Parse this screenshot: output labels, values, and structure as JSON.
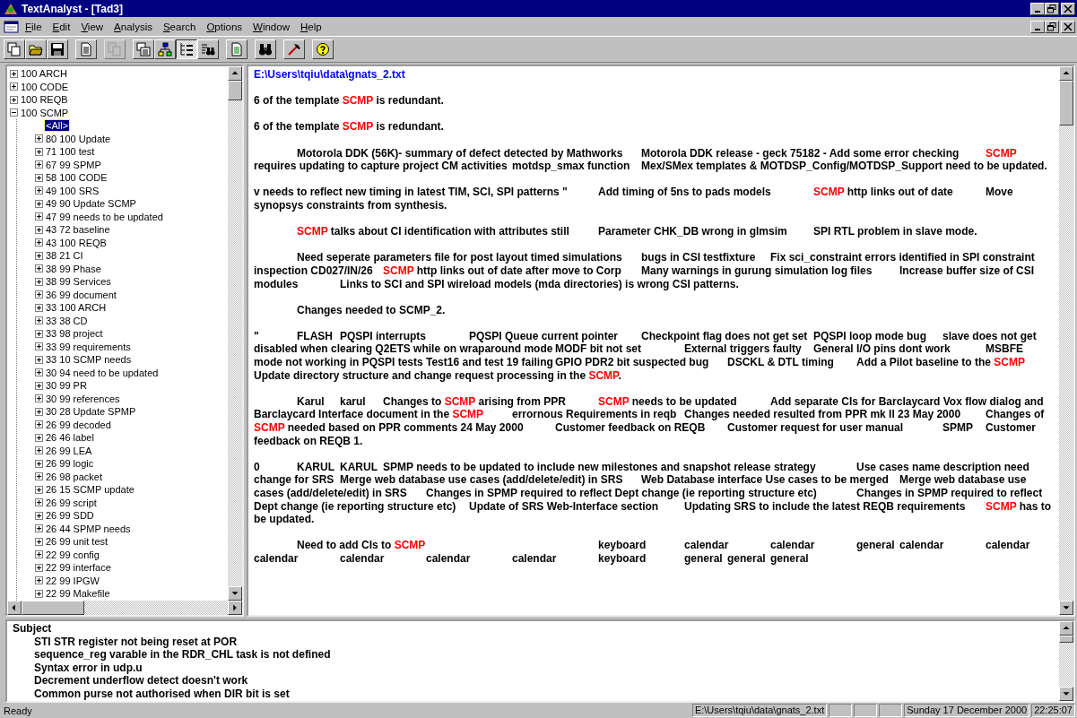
{
  "window": {
    "title": "TextAnalyst - [Tad3]"
  },
  "menu": [
    "File",
    "Edit",
    "View",
    "Analysis",
    "Search",
    "Options",
    "Window",
    "Help"
  ],
  "toolbar": [
    [
      {
        "pressed": false,
        "disabled": false
      },
      {
        "pressed": false,
        "disabled": false
      },
      {
        "pressed": false,
        "disabled": false
      }
    ],
    [
      {
        "pressed": false,
        "disabled": false
      }
    ],
    [
      {
        "pressed": false,
        "disabled": true
      }
    ],
    [
      {
        "pressed": false,
        "disabled": false
      },
      {
        "pressed": false,
        "disabled": false
      },
      {
        "pressed": true,
        "disabled": false
      },
      {
        "pressed": false,
        "disabled": false
      }
    ],
    [
      {
        "pressed": false,
        "disabled": false
      }
    ],
    [
      {
        "pressed": false,
        "disabled": false
      }
    ],
    [
      {
        "pressed": false,
        "disabled": false
      }
    ],
    [
      {
        "pressed": false,
        "disabled": false
      }
    ]
  ],
  "tree": [
    {
      "label": "100 ARCH",
      "expanded": false,
      "selected": false
    },
    {
      "label": "100 CODE",
      "expanded": false,
      "selected": false
    },
    {
      "label": "100 REQB",
      "expanded": false,
      "selected": false
    },
    {
      "label": "100 SCMP",
      "expanded": true,
      "selected": false,
      "children": [
        {
          "label": "<All>",
          "selected": true
        },
        {
          "label": "80 100 Update",
          "expanded": false,
          "selected": false
        },
        {
          "label": "71 100 test",
          "expanded": false,
          "selected": false
        },
        {
          "label": "67 99 SPMP",
          "expanded": false,
          "selected": false
        },
        {
          "label": "58 100 CODE",
          "expanded": false,
          "selected": false
        },
        {
          "label": "49 100 SRS",
          "expanded": false,
          "selected": false
        },
        {
          "label": "49 90 Update SCMP",
          "expanded": false,
          "selected": false
        },
        {
          "label": "47 99 needs to be updated",
          "expanded": false,
          "selected": false
        },
        {
          "label": "43 72 baseline",
          "expanded": false,
          "selected": false
        },
        {
          "label": "43 100 REQB",
          "expanded": false,
          "selected": false
        },
        {
          "label": "38 21 CI",
          "expanded": false,
          "selected": false
        },
        {
          "label": "38 99 Phase",
          "expanded": false,
          "selected": false
        },
        {
          "label": "38 99 Services",
          "expanded": false,
          "selected": false
        },
        {
          "label": "36 99 document",
          "expanded": false,
          "selected": false
        },
        {
          "label": "33 100 ARCH",
          "expanded": false,
          "selected": false
        },
        {
          "label": "33 38 CD",
          "expanded": false,
          "selected": false
        },
        {
          "label": "33 98 project",
          "expanded": false,
          "selected": false
        },
        {
          "label": "33 99 requirements",
          "expanded": false,
          "selected": false
        },
        {
          "label": "33 10 SCMP needs",
          "expanded": false,
          "selected": false
        },
        {
          "label": "30 94 need to be updated",
          "expanded": false,
          "selected": false
        },
        {
          "label": "30 99 PR",
          "expanded": false,
          "selected": false
        },
        {
          "label": "30 99 references",
          "expanded": false,
          "selected": false
        },
        {
          "label": "30 28 Update SPMP",
          "expanded": false,
          "selected": false
        },
        {
          "label": "26 99 decoded",
          "expanded": false,
          "selected": false
        },
        {
          "label": "26 46 label",
          "expanded": false,
          "selected": false
        },
        {
          "label": "26 99 LEA",
          "expanded": false,
          "selected": false
        },
        {
          "label": "26 99 logic",
          "expanded": false,
          "selected": false
        },
        {
          "label": "26 98 packet",
          "expanded": false,
          "selected": false
        },
        {
          "label": "26 15 SCMP update",
          "expanded": false,
          "selected": false
        },
        {
          "label": "26 99 script",
          "expanded": false,
          "selected": false
        },
        {
          "label": "26 99 SDD",
          "expanded": false,
          "selected": false
        },
        {
          "label": "26 44 SPMP needs",
          "expanded": false,
          "selected": false
        },
        {
          "label": "26 99 unit test",
          "expanded": false,
          "selected": false
        },
        {
          "label": "22 99 config",
          "expanded": false,
          "selected": false
        },
        {
          "label": "22 99 interface",
          "expanded": false,
          "selected": false
        },
        {
          "label": "22 99 IPGW",
          "expanded": false,
          "selected": false
        },
        {
          "label": "22 99 Makefile",
          "expanded": false,
          "selected": false
        }
      ]
    }
  ],
  "document": {
    "path": "E:\\Users\\tqiu\\data\\gnats_2.txt",
    "paragraphs": [
      "6 of the template *SCMP* is redundant.",
      "6 of the template *SCMP* is redundant.",
      "\tMotorola DDK (56K)- summary of defect detected by Mathworks\tMotorola DDK release - geck 75182 - Add some error checking\t*SCMP* requires updating to capture project CM activities\tmotdsp_smax function\tMex/SMex templates & MOTDSP_Config/MOTDSP_Support need to be updated.",
      "v needs to reflect new timing in latest TIM, SCI, SPI patterns \"\tAdd timing of 5ns to pads models\t*SCMP* http links out of date\tMove synopsys constraints from synthesis.",
      "\t*SCMP* talks about CI identification with attributes still\tParameter CHK_DB wrong in glmsim\tSPI RTL problem in slave mode.",
      "\tNeed seperate parameters file for post layout timed simulations\tbugs in CSI testfixture\tFix sci_constraint errors identified in SPI constraint inspection CD027/IN/26\t*SCMP* http links out of date after move to Corp\tMany warnings in gurung simulation log files\tIncrease buffer size of CSI modules\tLinks to SCI and SPI wireload models (mda directories) is wrong CSI patterns.",
      "\tChanges needed to SCMP_2.",
      "\"\tFLASH\tPQSPI interrupts\tPQSPI Queue current pointer\tCheckpoint flag does not get set\tPQSPI loop mode bug\tslave does not get disabled when clearing Q2ETS while on wraparound mode\tMODF bit not set\tExternal triggers faulty\tGeneral I/O pins dont work\tMSBFE mode not working in PQSPI tests\tTest16 and test 19 failing\tGPIO PDR2 bit suspected bug\tDSCKL & DTL timing\tAdd a Pilot baseline to the *SCMP*\tUpdate directory structure and change request processing in the *SCMP*.",
      "\tKarul\tkarul\tChanges to *SCMP* arising from PPR\t*SCMP* needs to be updated\tAdd separate CIs for Barclaycard Vox flow dialog and Barclaycard Interface document in the *SCMP*\terrornous Requirements in reqb\tChanges needed resulted from PPR mk II 23 May 2000\tChanges of *SCMP* needed based on PPR comments 24 May 2000\tCustomer feedback on REQB\tCustomer request for user manual\tSPMP\tCustomer feedback on REQB 1.",
      "0\tKARUL\tKARUL\tSPMP needs to be updated to include new milestones and snapshot release strategy\tUse cases name description need change for SRS\tMerge web database use cases (add/delete/edit) in SRS\tWeb Database interface Use cases to be merged\tMerge web database use cases (add/delete/edit) in SRS\tChanges in SPMP required to reflect Dept change (ie reporting structure etc)\tChanges in SPMP required to reflect Dept change (ie reporting structure etc)\tUpdate of SRS Web-Interface section\tUpdating SRS to include the latest REQB requirements\t*SCMP* has to be updated.",
      "\tNeed to add CIs to *SCMP*\t\t\t\tkeyboard\tcalendar\tcalendar\tgeneral\tcalendar\tcalendar\tcalendar\tcalendar\tcalendar\tcalendar\tkeyboard\tgeneral\tgeneral\tgeneral"
    ]
  },
  "subjects": {
    "heading": "Subject",
    "items": [
      "STI STR register not being reset at POR",
      "sequence_reg varable in the RDR_CHL task is not defined",
      "Syntax error in udp.u",
      "Decrement underflow detect doesn't work",
      "Common purse not authorised when DIR bit is set"
    ]
  },
  "status_bar": {
    "message": "Ready",
    "file": "E:\\Users\\tqiu\\data\\gnats_2.txt",
    "date": "Sunday 17 December 2000",
    "time": "22:25:07"
  }
}
